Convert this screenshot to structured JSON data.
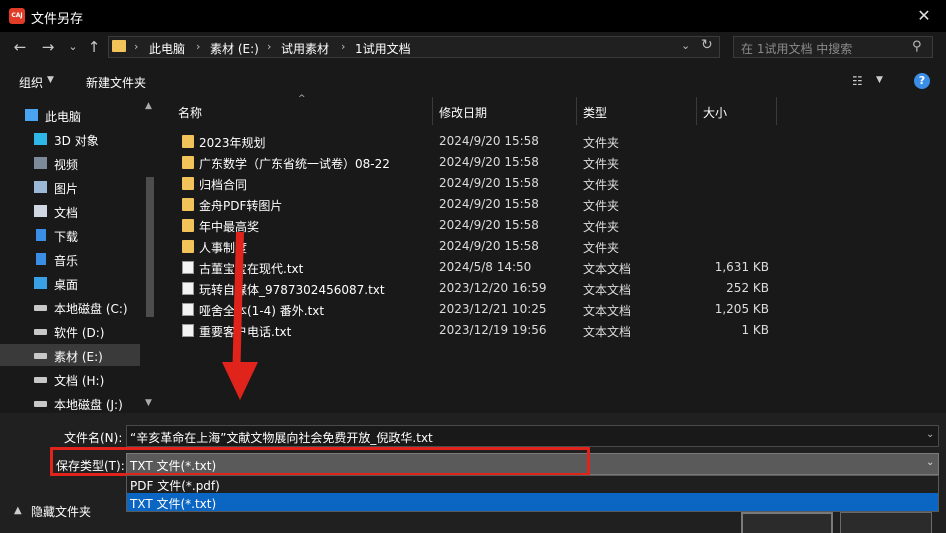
{
  "window": {
    "title": "文件另存",
    "app_icon_text": "CAJ",
    "close_symbol": "✕"
  },
  "nav": {
    "back": "←",
    "forward": "→",
    "recent": "⌄",
    "up": "↑",
    "breadcrumbs": [
      "此电脑",
      "素材 (E:)",
      "试用素材",
      "1试用文档"
    ],
    "separator": "›",
    "dropdown": "⌄",
    "refresh": "↻",
    "search_placeholder": "在 1试用文档 中搜索",
    "search_icon": "⚲"
  },
  "toolbar": {
    "organize": "组织",
    "organize_caret": "▼",
    "new_folder": "新建文件夹",
    "view_icon": "☷",
    "view_caret": "▼",
    "help": "?"
  },
  "sidebar": {
    "items": [
      {
        "label": "此电脑",
        "icon": "computer-icon",
        "color": "#4aa3f0",
        "selected": false
      },
      {
        "label": "3D 对象",
        "icon": "cube-icon",
        "color": "#2fb7e8",
        "selected": false
      },
      {
        "label": "视频",
        "icon": "video-icon",
        "color": "#7d8a99",
        "selected": false
      },
      {
        "label": "图片",
        "icon": "picture-icon",
        "color": "#9bb8d6",
        "selected": false
      },
      {
        "label": "文档",
        "icon": "document-icon",
        "color": "#cfd8e2",
        "selected": false
      },
      {
        "label": "下载",
        "icon": "download-icon",
        "color": "#3a8ee6",
        "selected": false
      },
      {
        "label": "音乐",
        "icon": "music-icon",
        "color": "#3a8ee6",
        "selected": false
      },
      {
        "label": "桌面",
        "icon": "desktop-icon",
        "color": "#3aa0e6",
        "selected": false
      },
      {
        "label": "本地磁盘 (C:)",
        "icon": "drive-icon",
        "color": "#c8c8c8",
        "selected": false
      },
      {
        "label": "软件 (D:)",
        "icon": "drive-icon",
        "color": "#c8c8c8",
        "selected": false
      },
      {
        "label": "素材 (E:)",
        "icon": "drive-icon",
        "color": "#c8c8c8",
        "selected": true
      },
      {
        "label": "文档 (H:)",
        "icon": "drive-icon",
        "color": "#c8c8c8",
        "selected": false
      },
      {
        "label": "本地磁盘 (J:)",
        "icon": "drive-icon",
        "color": "#c8c8c8",
        "selected": false
      }
    ],
    "scroll_up": "▲",
    "scroll_down": "▼"
  },
  "columns": {
    "name": "名称",
    "date": "修改日期",
    "type": "类型",
    "size": "大小",
    "sort_caret": "^"
  },
  "files": [
    {
      "name": "2023年规划",
      "date": "2024/9/20 15:58",
      "type": "文件夹",
      "size": "",
      "kind": "folder"
    },
    {
      "name": "广东数学（广东省统一试卷）08-22",
      "date": "2024/9/20 15:58",
      "type": "文件夹",
      "size": "",
      "kind": "folder"
    },
    {
      "name": "归档合同",
      "date": "2024/9/20 15:58",
      "type": "文件夹",
      "size": "",
      "kind": "folder"
    },
    {
      "name": "金舟PDF转图片",
      "date": "2024/9/20 15:58",
      "type": "文件夹",
      "size": "",
      "kind": "folder"
    },
    {
      "name": "年中最高奖",
      "date": "2024/9/20 15:58",
      "type": "文件夹",
      "size": "",
      "kind": "folder"
    },
    {
      "name": "人事制度",
      "date": "2024/9/20 15:58",
      "type": "文件夹",
      "size": "",
      "kind": "folder"
    },
    {
      "name": "古董宝宝在现代.txt",
      "date": "2024/5/8 14:50",
      "type": "文本文档",
      "size": "1,631 KB",
      "kind": "doc"
    },
    {
      "name": "玩转自媒体_9787302456087.txt",
      "date": "2023/12/20 16:59",
      "type": "文本文档",
      "size": "252 KB",
      "kind": "doc"
    },
    {
      "name": "哑舍全本(1-4) 番外.txt",
      "date": "2023/12/21 10:25",
      "type": "文本文档",
      "size": "1,205 KB",
      "kind": "doc"
    },
    {
      "name": "重要客户电话.txt",
      "date": "2023/12/19 19:56",
      "type": "文本文档",
      "size": "1 KB",
      "kind": "doc"
    }
  ],
  "save": {
    "filename_label": "文件名(N):",
    "filename_value": "“辛亥革命在上海”文献文物展向社会免费开放_倪政华.txt",
    "type_label": "保存类型(T):",
    "type_value": "TXT 文件(*.txt)",
    "dropdown_caret": "⌄",
    "options": [
      "PDF 文件(*.pdf)",
      "TXT 文件(*.txt)"
    ],
    "selected_option_index": 1,
    "hide_folders": "隐藏文件夹",
    "hide_caret": "▲"
  },
  "colors": {
    "highlight_red": "#e0241c",
    "selection_blue": "#0a66c2",
    "folder_yellow": "#f3c35b"
  }
}
